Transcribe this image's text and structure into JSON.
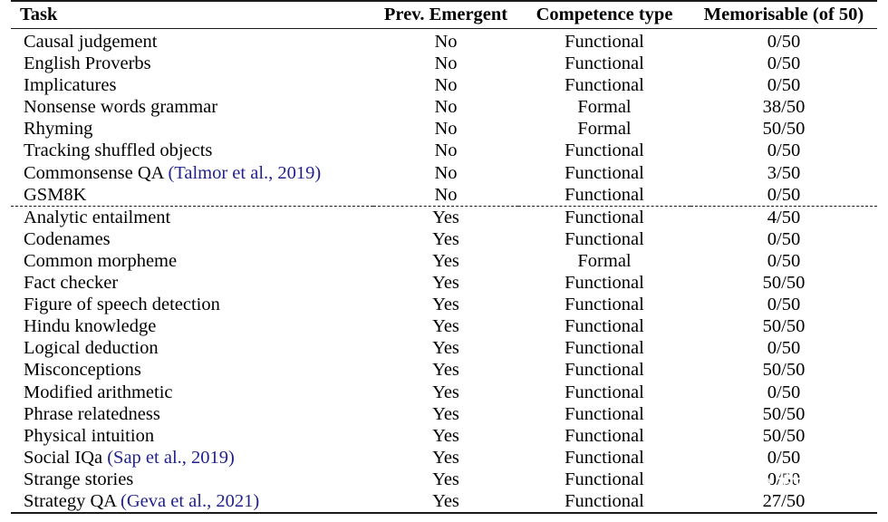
{
  "table": {
    "columns": [
      {
        "key": "task",
        "label": "Task"
      },
      {
        "key": "prev",
        "label": "Prev. Emergent"
      },
      {
        "key": "comp",
        "label": "Competence type"
      },
      {
        "key": "mem",
        "label": "Memorisable (of 50)"
      }
    ],
    "citation_color": "#21228c",
    "rule_color": "#1a1a1a",
    "groups": [
      {
        "separator_below": "dashed",
        "rows": [
          {
            "task": "Causal judgement",
            "task_cite": "",
            "prev": "No",
            "comp": "Functional",
            "mem": "0/50"
          },
          {
            "task": "English Proverbs",
            "task_cite": "",
            "prev": "No",
            "comp": "Functional",
            "mem": "0/50"
          },
          {
            "task": "Implicatures",
            "task_cite": "",
            "prev": "No",
            "comp": "Functional",
            "mem": "0/50"
          },
          {
            "task": "Nonsense words grammar",
            "task_cite": "",
            "prev": "No",
            "comp": "Formal",
            "mem": "38/50"
          },
          {
            "task": "Rhyming",
            "task_cite": "",
            "prev": "No",
            "comp": "Formal",
            "mem": "50/50"
          },
          {
            "task": "Tracking shuffled objects",
            "task_cite": "",
            "prev": "No",
            "comp": "Functional",
            "mem": "0/50"
          },
          {
            "task": "Commonsense QA ",
            "task_cite": "(Talmor et al., 2019)",
            "prev": "No",
            "comp": "Functional",
            "mem": "3/50"
          },
          {
            "task": "GSM8K",
            "task_cite": "",
            "prev": "No",
            "comp": "Functional",
            "mem": "0/50"
          }
        ]
      },
      {
        "separator_below": "none",
        "rows": [
          {
            "task": "Analytic entailment",
            "task_cite": "",
            "prev": "Yes",
            "comp": "Functional",
            "mem": "4/50"
          },
          {
            "task": "Codenames",
            "task_cite": "",
            "prev": "Yes",
            "comp": "Functional",
            "mem": "0/50"
          },
          {
            "task": "Common morpheme",
            "task_cite": "",
            "prev": "Yes",
            "comp": "Formal",
            "mem": "0/50"
          },
          {
            "task": "Fact checker",
            "task_cite": "",
            "prev": "Yes",
            "comp": "Functional",
            "mem": "50/50"
          },
          {
            "task": "Figure of speech detection",
            "task_cite": "",
            "prev": "Yes",
            "comp": "Functional",
            "mem": "0/50"
          },
          {
            "task": "Hindu knowledge",
            "task_cite": "",
            "prev": "Yes",
            "comp": "Functional",
            "mem": "50/50"
          },
          {
            "task": "Logical deduction",
            "task_cite": "",
            "prev": "Yes",
            "comp": "Functional",
            "mem": "0/50"
          },
          {
            "task": "Misconceptions",
            "task_cite": "",
            "prev": "Yes",
            "comp": "Functional",
            "mem": "50/50"
          },
          {
            "task": "Modified arithmetic",
            "task_cite": "",
            "prev": "Yes",
            "comp": "Functional",
            "mem": "0/50"
          },
          {
            "task": "Phrase relatedness",
            "task_cite": "",
            "prev": "Yes",
            "comp": "Functional",
            "mem": "50/50"
          },
          {
            "task": "Physical intuition",
            "task_cite": "",
            "prev": "Yes",
            "comp": "Functional",
            "mem": "50/50"
          },
          {
            "task": "Social IQa ",
            "task_cite": "(Sap et al., 2019)",
            "prev": "Yes",
            "comp": "Functional",
            "mem": "0/50"
          },
          {
            "task": "Strange stories",
            "task_cite": "",
            "prev": "Yes",
            "comp": "Functional",
            "mem": "0/50"
          },
          {
            "task": "Strategy QA ",
            "task_cite": "(Geva et al., 2021)",
            "prev": "Yes",
            "comp": "Functional",
            "mem": "27/50"
          }
        ]
      }
    ]
  },
  "watermark": {
    "text": "新智元",
    "icon": "chat-bubble-mascot-icon"
  }
}
